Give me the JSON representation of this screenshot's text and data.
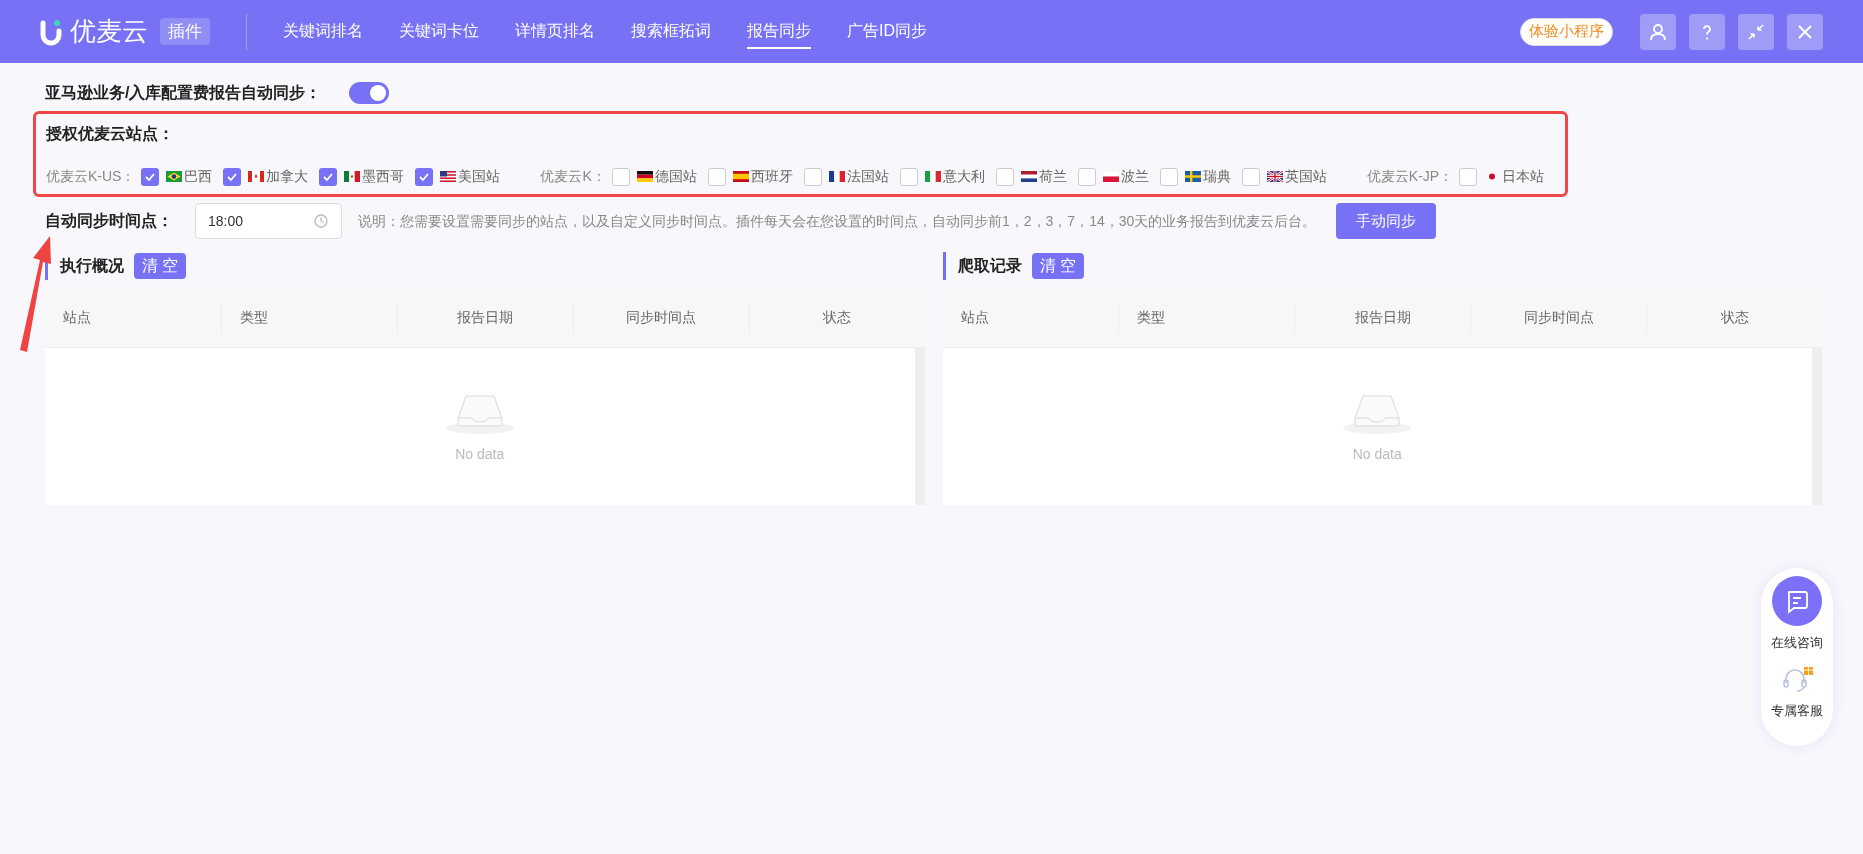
{
  "header": {
    "logo": "优麦云",
    "badge": "插件",
    "promo": "体验小程序",
    "nav": [
      {
        "label": "关键词排名",
        "selected": false
      },
      {
        "label": "关键词卡位",
        "selected": false
      },
      {
        "label": "详情页排名",
        "selected": false
      },
      {
        "label": "搜索框拓词",
        "selected": false
      },
      {
        "label": "报告同步",
        "selected": true
      },
      {
        "label": "广告ID同步",
        "selected": false
      }
    ]
  },
  "auto_sync": {
    "label": "亚马逊业务/入库配置费报告自动同步：",
    "on": true
  },
  "sites": {
    "title": "授权优麦云站点：",
    "groups": [
      {
        "label": "优麦云K-US：",
        "sites": [
          {
            "label": "巴西",
            "checked": true
          },
          {
            "label": "加拿大",
            "checked": true
          },
          {
            "label": "墨西哥",
            "checked": true
          },
          {
            "label": "美国站",
            "checked": true
          }
        ]
      },
      {
        "label": "优麦云K：",
        "sites": [
          {
            "label": "德国站",
            "checked": false
          },
          {
            "label": "西班牙",
            "checked": false
          },
          {
            "label": "法国站",
            "checked": false
          },
          {
            "label": "意大利",
            "checked": false
          },
          {
            "label": "荷兰",
            "checked": false
          },
          {
            "label": "波兰",
            "checked": false
          },
          {
            "label": "瑞典",
            "checked": false
          },
          {
            "label": "英国站",
            "checked": false
          }
        ]
      },
      {
        "label": "优麦云K-JP：",
        "sites": [
          {
            "label": "日本站",
            "checked": false
          }
        ]
      }
    ]
  },
  "sync_time": {
    "label": "自动同步时间点：",
    "value": "18:00",
    "note": "说明：您需要设置需要同步的站点，以及自定义同步时间点。插件每天会在您设置的时间点，自动同步前1，2，3，7，14，30天的业务报告到优麦云后台。",
    "button": "手动同步"
  },
  "panels": [
    {
      "title": "执行概况",
      "clear": "清空",
      "columns": [
        "站点",
        "类型",
        "报告日期",
        "同步时间点",
        "状态"
      ],
      "empty": "No data"
    },
    {
      "title": "爬取记录",
      "clear": "清空",
      "columns": [
        "站点",
        "类型",
        "报告日期",
        "同步时间点",
        "状态"
      ],
      "empty": "No data"
    }
  ],
  "float_panel": {
    "items": [
      "在线咨询",
      "专属客服"
    ]
  }
}
